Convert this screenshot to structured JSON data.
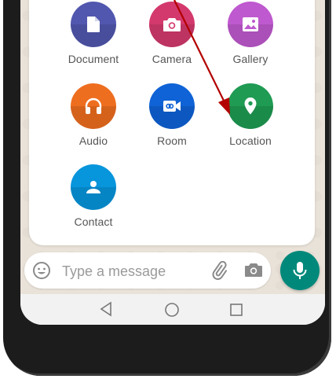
{
  "attach_menu": {
    "items": [
      {
        "label": "Document",
        "icon": "document-icon",
        "color": "#5157ae"
      },
      {
        "label": "Camera",
        "icon": "camera-icon",
        "color": "#d3396d"
      },
      {
        "label": "Gallery",
        "icon": "gallery-icon",
        "color": "#bf59cf"
      },
      {
        "label": "Audio",
        "icon": "headphones-icon",
        "color": "#ee6e1f"
      },
      {
        "label": "Room",
        "icon": "video-room-icon",
        "color": "#0f63d6"
      },
      {
        "label": "Location",
        "icon": "location-pin-icon",
        "color": "#1f9b53"
      },
      {
        "label": "Contact",
        "icon": "contact-icon",
        "color": "#0795dc"
      }
    ]
  },
  "input_bar": {
    "placeholder": "Type a message"
  },
  "colors": {
    "mic_button": "#00897b",
    "annotation_arrow": "#b30000"
  }
}
